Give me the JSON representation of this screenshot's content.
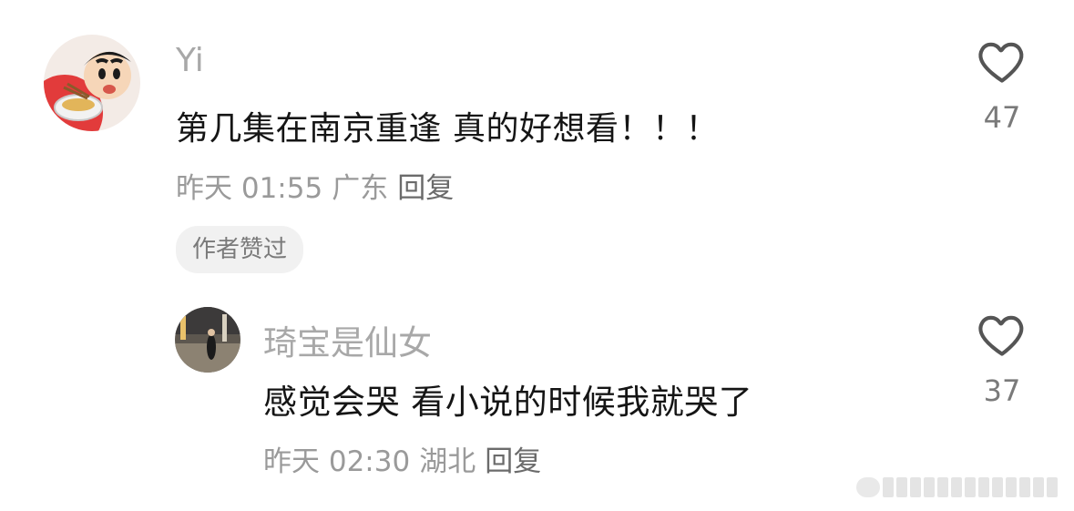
{
  "comments": [
    {
      "username": "Yi",
      "text": "第几集在南京重逢 真的好想看！！！",
      "time": "昨天 01:55",
      "location": "广东",
      "reply_label": "回复",
      "likes": "47",
      "badge": "作者赞过",
      "avatar_icon": "crayon-shinchan-ramen-avatar"
    },
    {
      "username": "琦宝是仙女",
      "text": "感觉会哭 看小说的时候我就哭了",
      "time": "昨天 02:30",
      "location": "湖北",
      "reply_label": "回复",
      "likes": "37",
      "avatar_icon": "photo-avatar-street-night"
    }
  ],
  "icons": {
    "like": "heart-outline-icon"
  },
  "colors": {
    "username": "#a8a8a8",
    "meta": "#9a9a9a",
    "badge_bg": "#f1f1f1"
  }
}
